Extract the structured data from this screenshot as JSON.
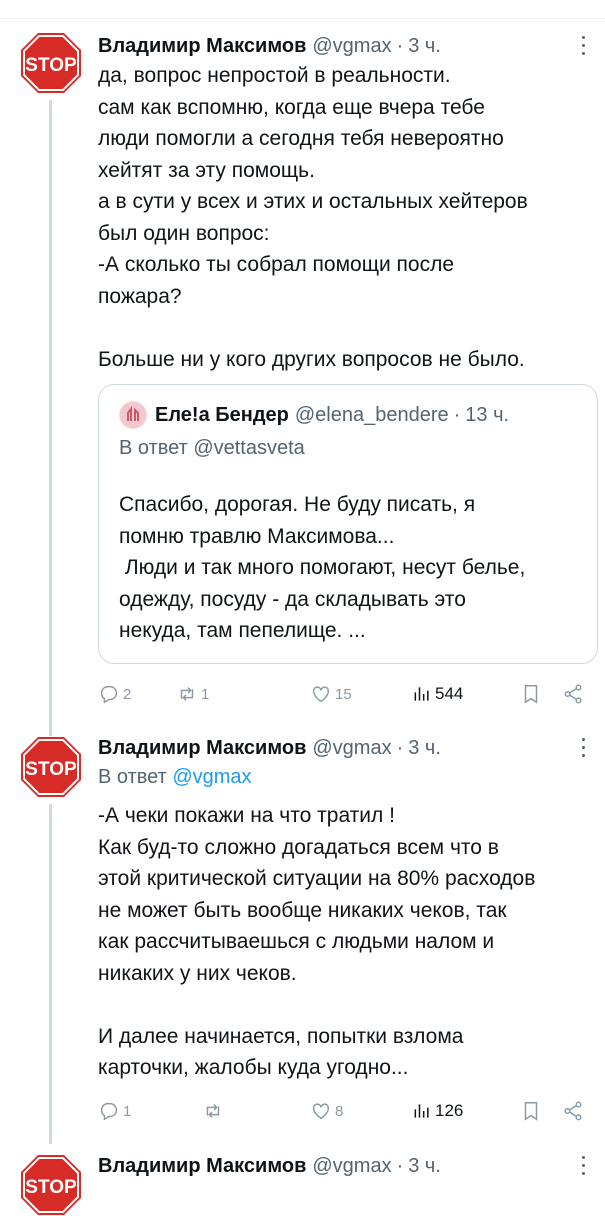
{
  "colors": {
    "accent": "#1d9bf0",
    "secondary": "#536471",
    "stop_red": "#d72b28"
  },
  "tweets": [
    {
      "avatar_text": "STOP",
      "name": "Владимир Максимов",
      "handle": "@vgmax",
      "dot": "·",
      "time": "3 ч.",
      "text": "да, вопрос непростой в реальности.\nсам как вспомню, когда еще вчера тебе\nлюди помогли а сегодня тебя невероятно\nхейтят за эту помощь.\nа в сути у всех и этих и остальных хейтеров\nбыл один вопрос:\n-А сколько ты собрал помощи после\nпожара?\n\nБольше ни у кого других вопросов не было.",
      "quote": {
        "name": "Еле!а Бендер",
        "handle": "@elena_bendere",
        "dot": "·",
        "time": "13 ч.",
        "reply_prefix": "В ответ",
        "reply_handle": "@vettasveta",
        "text": "Спасибо, дорогая. Не буду писать, я\nпомню травлю Максимова...\n Люди и так много помогают, несут белье,\nодежду, посуду - да складывать это\nнекуда, там пепелище. ..."
      },
      "replies": "2",
      "retweets": "1",
      "likes": "15",
      "views": "544"
    },
    {
      "avatar_text": "STOP",
      "name": "Владимир Максимов",
      "handle": "@vgmax",
      "dot": "·",
      "time": "3 ч.",
      "reply_prefix": "В ответ",
      "reply_handle": "@vgmax",
      "text": "-А чеки покажи на что тратил !\nКак буд-то сложно догадаться всем что в\nэтой критической ситуации на 80% расходов\nне может быть вообще никаких чеков, так\nкак рассчитываешься с людьми налом и\nникаких у них чеков.\n\nИ далее начинается, попытки взлома\nкарточки, жалобы куда угодно...",
      "replies": "1",
      "retweets": "",
      "likes": "8",
      "views": "126"
    },
    {
      "avatar_text": "STOP",
      "name": "Владимир Максимов",
      "handle": "@vgmax",
      "dot": "·",
      "time": "3 ч."
    }
  ]
}
